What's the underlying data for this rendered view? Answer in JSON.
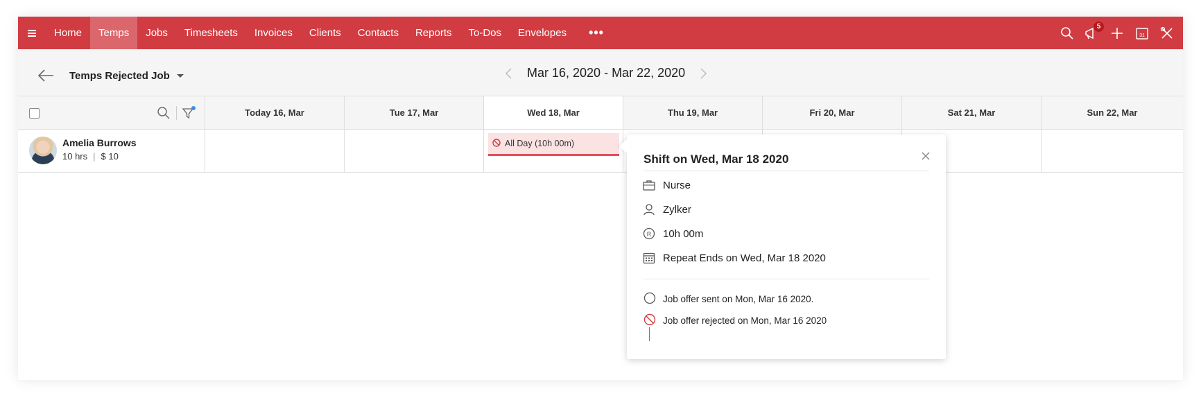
{
  "nav": {
    "items": [
      {
        "label": "Home",
        "active": false
      },
      {
        "label": "Temps",
        "active": true
      },
      {
        "label": "Jobs",
        "active": false
      },
      {
        "label": "Timesheets",
        "active": false
      },
      {
        "label": "Invoices",
        "active": false
      },
      {
        "label": "Clients",
        "active": false
      },
      {
        "label": "Contacts",
        "active": false
      },
      {
        "label": "Reports",
        "active": false
      },
      {
        "label": "To-Dos",
        "active": false
      },
      {
        "label": "Envelopes",
        "active": false
      }
    ],
    "more": "•••",
    "notification_count": "5",
    "calendar_day": "31",
    "brand_color": "#d13c43"
  },
  "subheader": {
    "view_label": "Temps Rejected Job",
    "date_range": "Mar 16, 2020 - Mar 22, 2020"
  },
  "days": [
    {
      "label": "Today 16, Mar"
    },
    {
      "label": "Tue 17, Mar"
    },
    {
      "label": "Wed 18, Mar"
    },
    {
      "label": "Thu 19, Mar"
    },
    {
      "label": "Fri 20, Mar"
    },
    {
      "label": "Sat 21, Mar"
    },
    {
      "label": "Sun 22, Mar"
    }
  ],
  "row": {
    "name": "Amelia Burrows",
    "hours": "10 hrs",
    "separator": "|",
    "amount": "$ 10",
    "shift_label": "All Day (10h 00m)"
  },
  "popover": {
    "title": "Shift on Wed, Mar 18 2020",
    "job": "Nurse",
    "client": "Zylker",
    "duration": "10h 00m",
    "repeat": "Repeat Ends on Wed, Mar 18 2020",
    "timeline": [
      {
        "text": "Job offer sent on Mon, Mar 16 2020."
      },
      {
        "text": "Job offer rejected on Mon, Mar 16 2020"
      }
    ]
  }
}
